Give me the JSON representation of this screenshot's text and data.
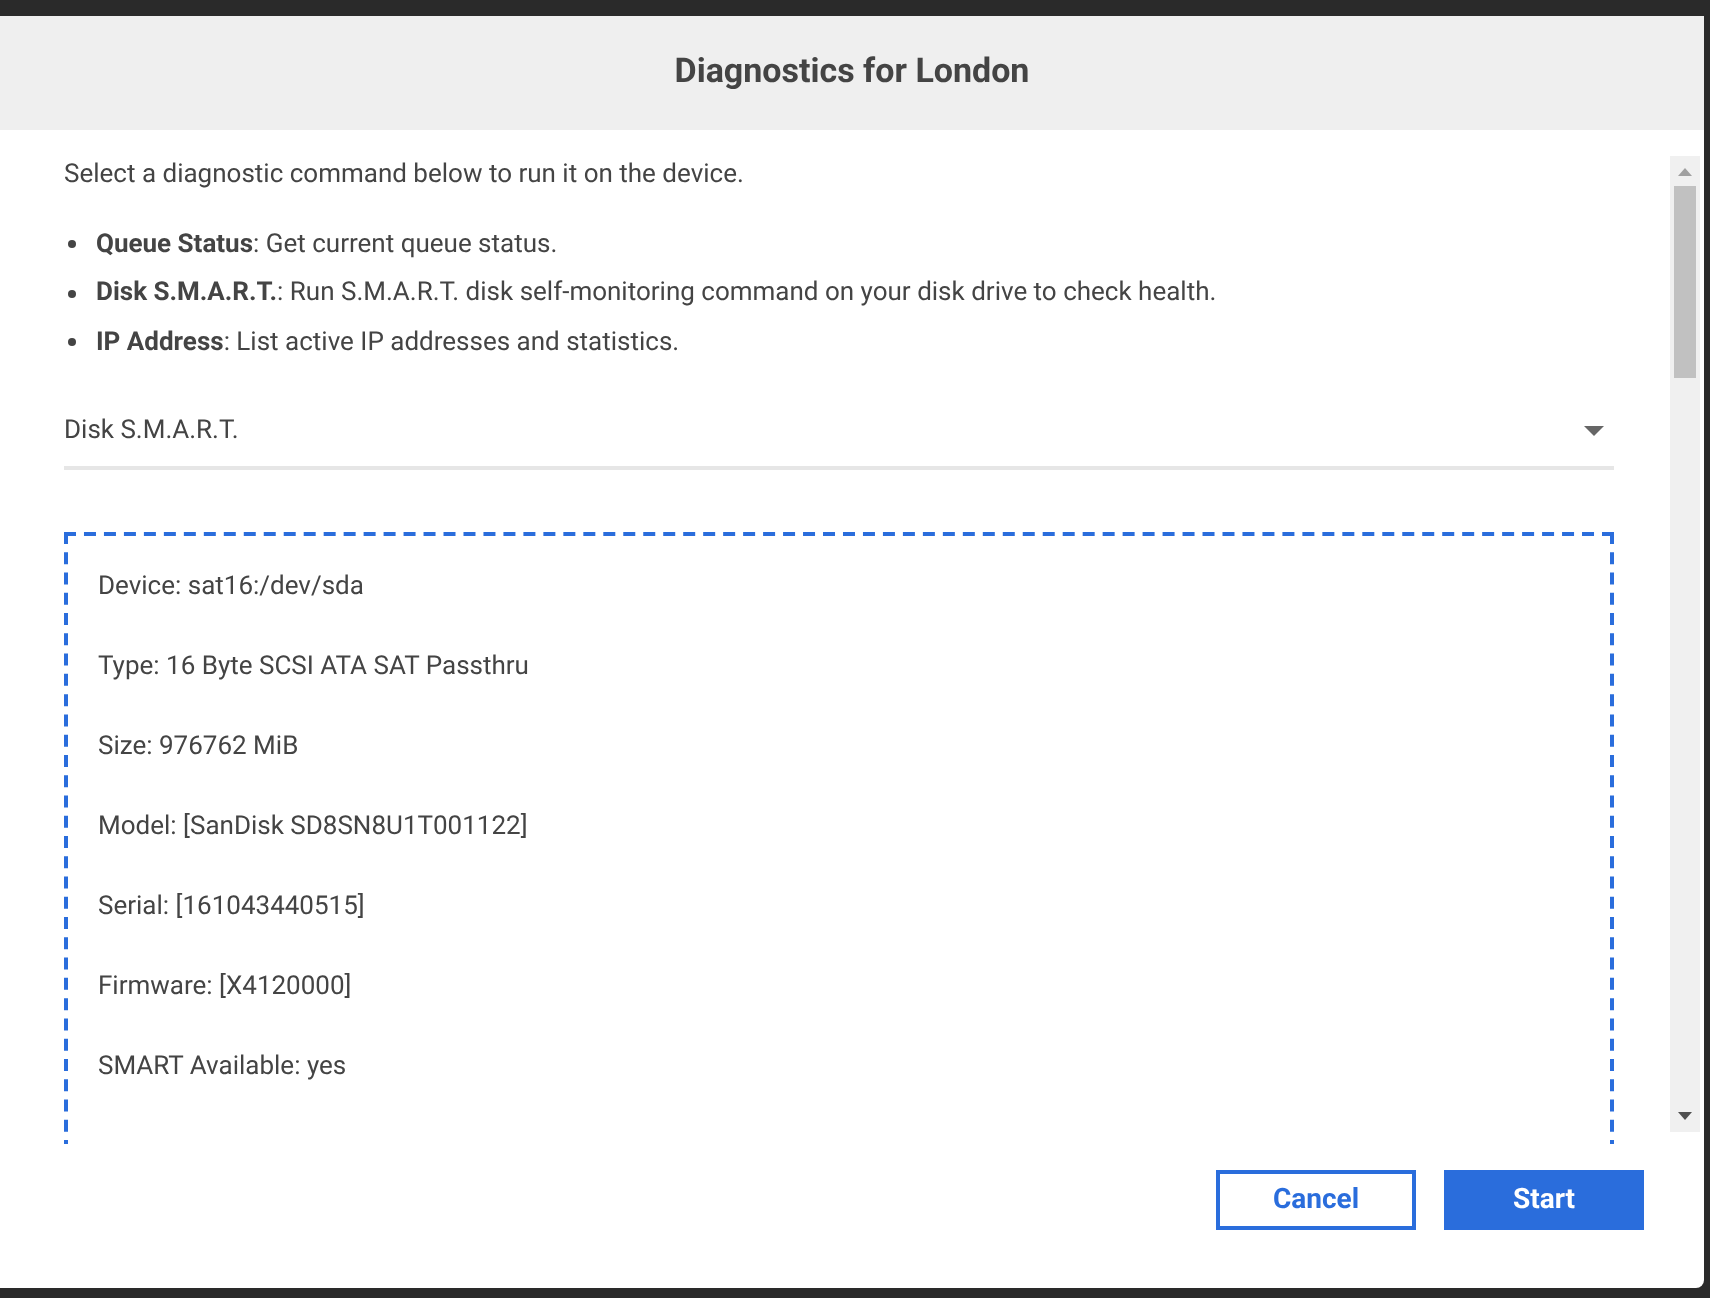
{
  "dialog": {
    "title": "Diagnostics for London",
    "intro": "Select a diagnostic command below to run it on the device.",
    "commands": [
      {
        "name": "Queue Status",
        "description": ": Get current queue status."
      },
      {
        "name": "Disk S.M.A.R.T.",
        "description": ": Run S.M.A.R.T. disk self-monitoring command on your disk drive to check health."
      },
      {
        "name": "IP Address",
        "description": ": List active IP addresses and statistics."
      }
    ],
    "select": {
      "value": "Disk S.M.A.R.T."
    },
    "output": [
      "Device: sat16:/dev/sda",
      "Type: 16 Byte SCSI ATA SAT Passthru",
      "Size: 976762 MiB",
      "Model: [SanDisk SD8SN8U1T001122]",
      "Serial: [161043440515]",
      "Firmware: [X4120000]",
      "SMART Available: yes"
    ],
    "buttons": [
      {
        "label": "Cancel",
        "kind": "secondary"
      },
      {
        "label": "Start",
        "kind": "primary"
      }
    ]
  }
}
